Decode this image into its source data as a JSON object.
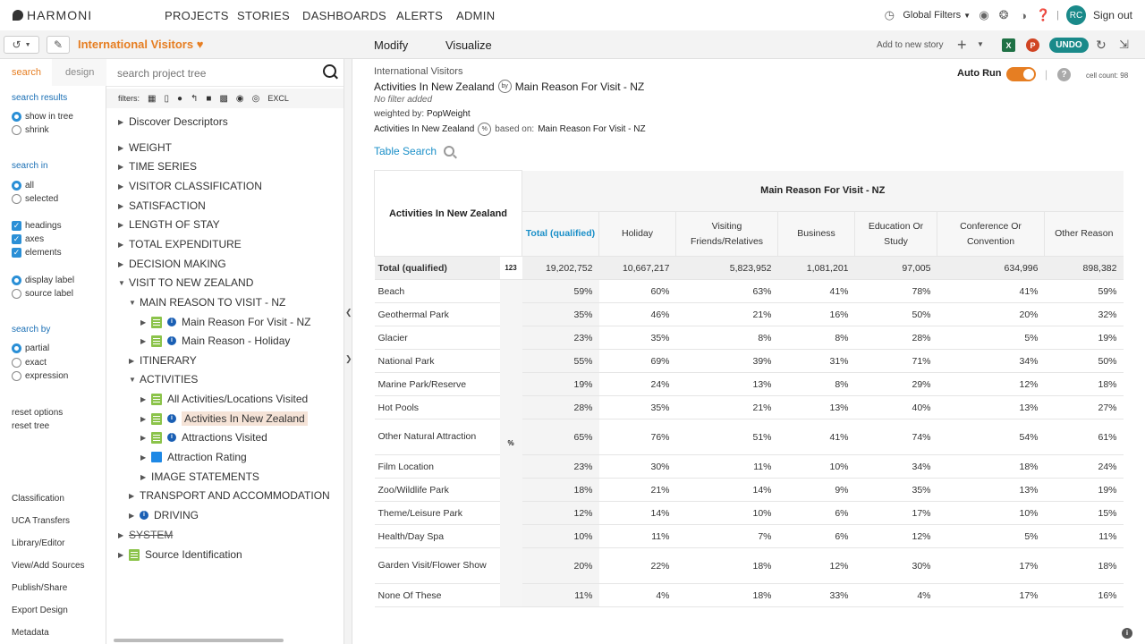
{
  "app": {
    "logo": "HARMONI",
    "nav": [
      "PROJECTS",
      "STORIES",
      "DASHBOARDS",
      "ALERTS",
      "ADMIN"
    ],
    "global_filters": "Global Filters",
    "avatar": "RC",
    "sign_out": "Sign out"
  },
  "toolbar": {
    "project_title": "International Visitors",
    "modify": "Modify",
    "visualize": "Visualize",
    "add_to_story": "Add to new story",
    "undo": "UNDO"
  },
  "options": {
    "tab_search": "search",
    "tab_design": "design",
    "search_results_head": "search results",
    "show_in_tree": "show in tree",
    "shrink": "shrink",
    "search_in_head": "search in",
    "all": "all",
    "selected": "selected",
    "headings": "headings",
    "axes": "axes",
    "elements": "elements",
    "display_label": "display label",
    "source_label": "source label",
    "search_by_head": "search by",
    "partial": "partial",
    "exact": "exact",
    "expression": "expression",
    "reset_options": "reset options",
    "reset_tree": "reset tree",
    "links": [
      "Classification",
      "UCA Transfers",
      "Library/Editor",
      "View/Add Sources",
      "Publish/Share",
      "Export Design",
      "Metadata"
    ]
  },
  "tree": {
    "search_placeholder": "search project tree",
    "filters_label": "filters:",
    "excl": "EXCL",
    "nodes": [
      {
        "label": "Discover Descriptors"
      },
      {
        "label": "WEIGHT"
      },
      {
        "label": "TIME SERIES"
      },
      {
        "label": "VISITOR CLASSIFICATION"
      },
      {
        "label": "SATISFACTION"
      },
      {
        "label": "LENGTH OF STAY"
      },
      {
        "label": "TOTAL EXPENDITURE"
      },
      {
        "label": "DECISION MAKING"
      },
      {
        "label": "VISIT TO NEW ZEALAND"
      },
      {
        "label": "MAIN REASON TO VISIT - NZ"
      },
      {
        "label": "Main Reason For Visit - NZ"
      },
      {
        "label": "Main Reason - Holiday"
      },
      {
        "label": "ITINERARY"
      },
      {
        "label": "ACTIVITIES"
      },
      {
        "label": "All Activities/Locations Visited"
      },
      {
        "label": "Activities In New Zealand"
      },
      {
        "label": "Attractions Visited"
      },
      {
        "label": "Attraction Rating"
      },
      {
        "label": "IMAGE STATEMENTS"
      },
      {
        "label": "TRANSPORT AND ACCOMMODATION"
      },
      {
        "label": "DRIVING"
      },
      {
        "label": "SYSTEM"
      },
      {
        "label": "Source Identification"
      }
    ]
  },
  "main": {
    "crumb": "International Visitors",
    "rows_var": "Activities In New Zealand",
    "by": "by",
    "cols_var": "Main Reason For Visit - NZ",
    "no_filter": "No filter added",
    "weighted_prefix": "weighted by:",
    "weighted_var": "PopWeight",
    "basedon_var": "Activities In New Zealand",
    "basedon_prefix": "based on:",
    "basedon_val": "Main Reason For Visit - NZ",
    "table_search": "Table Search",
    "auto_run": "Auto Run",
    "cell_count": "cell count: 98",
    "table": {
      "corner_label": "Activities In New Zealand",
      "header_label": "Main Reason For Visit - NZ",
      "columns": [
        "Total (qualified)",
        "Holiday",
        "Visiting Friends/Relatives",
        "Business",
        "Education Or Study",
        "Conference Or Convention",
        "Other Reason"
      ],
      "total_label": "Total (qualified)",
      "total_stat": "123",
      "pct_stat": "%",
      "totals": [
        "19,202,752",
        "10,667,217",
        "5,823,952",
        "1,081,201",
        "97,005",
        "634,996",
        "898,382"
      ],
      "rows": [
        {
          "label": "Beach",
          "values": [
            "59%",
            "60%",
            "63%",
            "41%",
            "78%",
            "41%",
            "59%"
          ]
        },
        {
          "label": "Geothermal Park",
          "values": [
            "35%",
            "46%",
            "21%",
            "16%",
            "50%",
            "20%",
            "32%"
          ]
        },
        {
          "label": "Glacier",
          "values": [
            "23%",
            "35%",
            "8%",
            "8%",
            "28%",
            "5%",
            "19%"
          ]
        },
        {
          "label": "National Park",
          "values": [
            "55%",
            "69%",
            "39%",
            "31%",
            "71%",
            "34%",
            "50%"
          ]
        },
        {
          "label": "Marine Park/Reserve",
          "values": [
            "19%",
            "24%",
            "13%",
            "8%",
            "29%",
            "12%",
            "18%"
          ]
        },
        {
          "label": "Hot Pools",
          "values": [
            "28%",
            "35%",
            "21%",
            "13%",
            "40%",
            "13%",
            "27%"
          ]
        },
        {
          "label": "Other Natural Attraction",
          "values": [
            "65%",
            "76%",
            "51%",
            "41%",
            "74%",
            "54%",
            "61%"
          ]
        },
        {
          "label": "Film Location",
          "values": [
            "23%",
            "30%",
            "11%",
            "10%",
            "34%",
            "18%",
            "24%"
          ]
        },
        {
          "label": "Zoo/Wildlife Park",
          "values": [
            "18%",
            "21%",
            "14%",
            "9%",
            "35%",
            "13%",
            "19%"
          ]
        },
        {
          "label": "Theme/Leisure Park",
          "values": [
            "12%",
            "14%",
            "10%",
            "6%",
            "17%",
            "10%",
            "15%"
          ]
        },
        {
          "label": "Health/Day Spa",
          "values": [
            "10%",
            "11%",
            "7%",
            "6%",
            "12%",
            "5%",
            "11%"
          ]
        },
        {
          "label": "Garden Visit/Flower Show",
          "values": [
            "20%",
            "22%",
            "18%",
            "12%",
            "30%",
            "17%",
            "18%"
          ]
        },
        {
          "label": "None Of These",
          "values": [
            "11%",
            "4%",
            "18%",
            "33%",
            "4%",
            "17%",
            "16%"
          ]
        }
      ]
    }
  },
  "colors": {
    "accent": "#e67e22",
    "teal": "#1a8a8a",
    "link": "#1a8fc8"
  }
}
